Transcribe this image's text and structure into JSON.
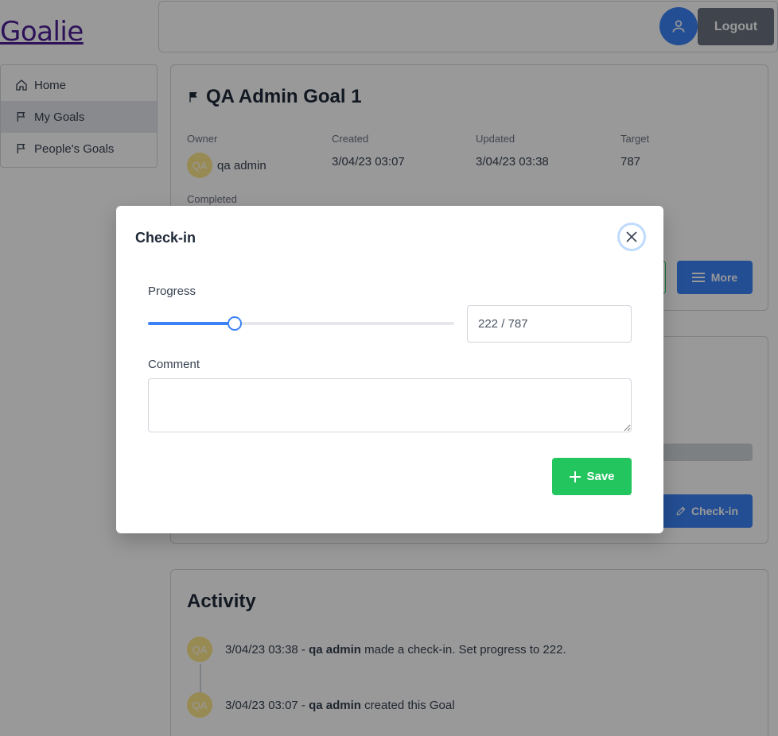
{
  "app": {
    "logo": "Goalie"
  },
  "header": {
    "logout_label": "Logout",
    "avatar_icon": "user-icon"
  },
  "sidebar": {
    "items": [
      {
        "label": "Home",
        "icon": "home-icon"
      },
      {
        "label": "My Goals",
        "icon": "flag-icon",
        "active": true
      },
      {
        "label": "People's Goals",
        "icon": "flag-icon"
      }
    ]
  },
  "goal": {
    "title": "QA Admin Goal 1",
    "owner_label": "Owner",
    "owner_initials": "QA",
    "owner_name": "qa admin",
    "created_label": "Created",
    "created_value": "3/04/23 03:07",
    "updated_label": "Updated",
    "updated_value": "3/04/23 03:38",
    "target_label": "Target",
    "target_value": "787",
    "completed_label": "Completed",
    "more_label": "More"
  },
  "progress_card": {
    "checkin_label": "Check-in"
  },
  "activity": {
    "title": "Activity",
    "items": [
      {
        "initials": "QA",
        "time": "3/04/23 03:38",
        "user": "qa admin",
        "text": "made a check-in. Set progress to 222."
      },
      {
        "initials": "QA",
        "time": "3/04/23 03:07",
        "user": "qa admin",
        "text": "created this Goal"
      }
    ]
  },
  "modal": {
    "title": "Check-in",
    "progress_label": "Progress",
    "progress_value": 222,
    "progress_max": 787,
    "progress_text": "222 / 787",
    "comment_label": "Comment",
    "comment_value": "",
    "save_label": "Save"
  },
  "colors": {
    "primary": "#3b82f6",
    "success": "#22c55e",
    "overlay": "rgba(0,0,0,0.4)"
  }
}
